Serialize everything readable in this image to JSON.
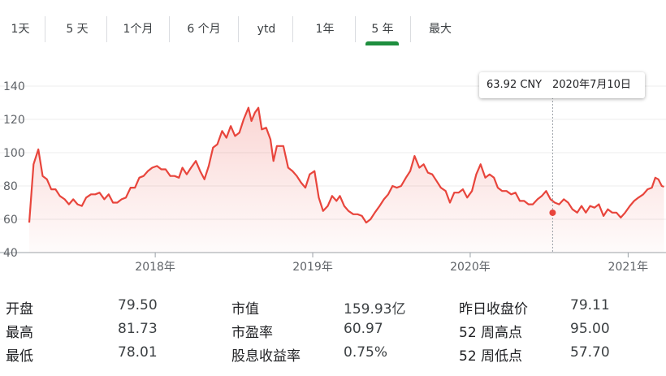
{
  "range_tabs": {
    "items": [
      {
        "label": "1天"
      },
      {
        "label": "5 天"
      },
      {
        "label": "1个月"
      },
      {
        "label": "6 个月"
      },
      {
        "label": "ytd"
      },
      {
        "label": "1年"
      },
      {
        "label": "5 年"
      },
      {
        "label": "最大"
      }
    ],
    "active_index": 6,
    "active_color": "#1e8e3e"
  },
  "tooltip": {
    "price": "63.92 CNY",
    "date": "2020年7月10日"
  },
  "chart_data": {
    "type": "area",
    "line_color": "#e8453c",
    "ylim": [
      40,
      140
    ],
    "yticks": [
      40,
      60,
      80,
      100,
      120,
      140
    ],
    "xticks": [
      {
        "label": "2018年",
        "date": "2018-01-01"
      },
      {
        "label": "2019年",
        "date": "2019-01-01"
      },
      {
        "label": "2020年",
        "date": "2020-01-01"
      },
      {
        "label": "2021年",
        "date": "2021-01-01"
      }
    ],
    "grid": true,
    "highlight": {
      "date": "2020-07-10",
      "value": 63.92
    },
    "series": [
      {
        "points": [
          [
            "2017-03-15",
            58
          ],
          [
            "2017-03-25",
            93
          ],
          [
            "2017-04-05",
            102
          ],
          [
            "2017-04-15",
            86
          ],
          [
            "2017-04-25",
            84
          ],
          [
            "2017-05-05",
            78
          ],
          [
            "2017-05-15",
            78
          ],
          [
            "2017-05-25",
            74
          ],
          [
            "2017-06-05",
            72
          ],
          [
            "2017-06-15",
            69
          ],
          [
            "2017-06-25",
            72
          ],
          [
            "2017-07-05",
            69
          ],
          [
            "2017-07-15",
            68
          ],
          [
            "2017-07-25",
            73
          ],
          [
            "2017-08-05",
            75
          ],
          [
            "2017-08-15",
            75
          ],
          [
            "2017-08-25",
            76
          ],
          [
            "2017-09-05",
            72
          ],
          [
            "2017-09-15",
            75
          ],
          [
            "2017-09-25",
            70
          ],
          [
            "2017-10-05",
            70
          ],
          [
            "2017-10-15",
            72
          ],
          [
            "2017-10-25",
            73
          ],
          [
            "2017-11-05",
            79
          ],
          [
            "2017-11-15",
            79
          ],
          [
            "2017-11-25",
            85
          ],
          [
            "2017-12-05",
            86
          ],
          [
            "2017-12-15",
            89
          ],
          [
            "2017-12-25",
            91
          ],
          [
            "2018-01-05",
            92
          ],
          [
            "2018-01-15",
            90
          ],
          [
            "2018-01-25",
            90
          ],
          [
            "2018-02-05",
            86
          ],
          [
            "2018-02-15",
            86
          ],
          [
            "2018-02-25",
            85
          ],
          [
            "2018-03-05",
            91
          ],
          [
            "2018-03-15",
            87
          ],
          [
            "2018-03-25",
            91
          ],
          [
            "2018-04-05",
            95
          ],
          [
            "2018-04-15",
            89
          ],
          [
            "2018-04-25",
            84
          ],
          [
            "2018-05-05",
            92
          ],
          [
            "2018-05-15",
            103
          ],
          [
            "2018-05-25",
            105
          ],
          [
            "2018-06-05",
            113
          ],
          [
            "2018-06-15",
            109
          ],
          [
            "2018-06-25",
            116
          ],
          [
            "2018-07-05",
            110
          ],
          [
            "2018-07-15",
            112
          ],
          [
            "2018-07-25",
            120
          ],
          [
            "2018-08-05",
            127
          ],
          [
            "2018-08-12",
            119
          ],
          [
            "2018-08-20",
            124
          ],
          [
            "2018-08-28",
            127
          ],
          [
            "2018-09-05",
            114
          ],
          [
            "2018-09-15",
            115
          ],
          [
            "2018-09-25",
            108
          ],
          [
            "2018-10-02",
            95
          ],
          [
            "2018-10-10",
            104
          ],
          [
            "2018-10-25",
            104
          ],
          [
            "2018-11-05",
            91
          ],
          [
            "2018-11-15",
            89
          ],
          [
            "2018-11-25",
            86
          ],
          [
            "2018-12-05",
            82
          ],
          [
            "2018-12-15",
            79
          ],
          [
            "2018-12-25",
            87
          ],
          [
            "2019-01-05",
            89
          ],
          [
            "2019-01-15",
            73
          ],
          [
            "2019-01-25",
            65
          ],
          [
            "2019-02-05",
            68
          ],
          [
            "2019-02-15",
            74
          ],
          [
            "2019-02-25",
            71
          ],
          [
            "2019-03-05",
            74
          ],
          [
            "2019-03-15",
            68
          ],
          [
            "2019-03-25",
            65
          ],
          [
            "2019-04-05",
            63
          ],
          [
            "2019-04-15",
            63
          ],
          [
            "2019-04-25",
            62
          ],
          [
            "2019-05-05",
            58
          ],
          [
            "2019-05-15",
            60
          ],
          [
            "2019-05-25",
            64
          ],
          [
            "2019-06-05",
            68
          ],
          [
            "2019-06-15",
            72
          ],
          [
            "2019-06-25",
            75
          ],
          [
            "2019-07-05",
            80
          ],
          [
            "2019-07-15",
            79
          ],
          [
            "2019-07-25",
            80
          ],
          [
            "2019-08-05",
            85
          ],
          [
            "2019-08-15",
            89
          ],
          [
            "2019-08-25",
            98
          ],
          [
            "2019-09-05",
            91
          ],
          [
            "2019-09-15",
            93
          ],
          [
            "2019-09-25",
            88
          ],
          [
            "2019-10-05",
            87
          ],
          [
            "2019-10-15",
            83
          ],
          [
            "2019-10-25",
            79
          ],
          [
            "2019-11-05",
            77
          ],
          [
            "2019-11-15",
            70
          ],
          [
            "2019-11-25",
            76
          ],
          [
            "2019-12-05",
            76
          ],
          [
            "2019-12-15",
            78
          ],
          [
            "2019-12-25",
            73
          ],
          [
            "2020-01-05",
            77
          ],
          [
            "2020-01-15",
            87
          ],
          [
            "2020-01-25",
            93
          ],
          [
            "2020-02-05",
            85
          ],
          [
            "2020-02-15",
            87
          ],
          [
            "2020-02-25",
            85
          ],
          [
            "2020-03-05",
            79
          ],
          [
            "2020-03-15",
            77
          ],
          [
            "2020-03-25",
            77
          ],
          [
            "2020-04-05",
            75
          ],
          [
            "2020-04-15",
            76
          ],
          [
            "2020-04-25",
            71
          ],
          [
            "2020-05-05",
            71
          ],
          [
            "2020-05-15",
            69
          ],
          [
            "2020-05-25",
            69
          ],
          [
            "2020-06-05",
            72
          ],
          [
            "2020-06-15",
            74
          ],
          [
            "2020-06-25",
            77
          ],
          [
            "2020-07-05",
            72
          ],
          [
            "2020-07-15",
            70
          ],
          [
            "2020-07-25",
            69
          ],
          [
            "2020-08-05",
            72
          ],
          [
            "2020-08-15",
            70
          ],
          [
            "2020-08-25",
            66
          ],
          [
            "2020-09-05",
            64
          ],
          [
            "2020-09-15",
            68
          ],
          [
            "2020-09-25",
            64
          ],
          [
            "2020-10-05",
            68
          ],
          [
            "2020-10-15",
            67
          ],
          [
            "2020-10-25",
            69
          ],
          [
            "2020-11-05",
            62
          ],
          [
            "2020-11-15",
            66
          ],
          [
            "2020-11-25",
            64
          ],
          [
            "2020-12-05",
            64
          ],
          [
            "2020-12-15",
            61
          ],
          [
            "2020-12-25",
            64
          ],
          [
            "2021-01-05",
            68
          ],
          [
            "2021-01-15",
            71
          ],
          [
            "2021-01-25",
            73
          ],
          [
            "2021-02-05",
            75
          ],
          [
            "2021-02-15",
            78
          ],
          [
            "2021-02-25",
            79
          ],
          [
            "2021-03-05",
            85
          ],
          [
            "2021-03-12",
            84
          ],
          [
            "2021-03-20",
            80
          ],
          [
            "2021-03-25",
            79.5
          ]
        ]
      }
    ]
  },
  "stats": [
    {
      "label": "开盘",
      "value": "79.50"
    },
    {
      "label": "市值",
      "value": "159.93亿"
    },
    {
      "label": "昨日收盘价",
      "value": "79.11"
    },
    {
      "label": "最高",
      "value": "81.73"
    },
    {
      "label": "市盈率",
      "value": "60.97"
    },
    {
      "label": "52 周高点",
      "value": "95.00"
    },
    {
      "label": "最低",
      "value": "78.01"
    },
    {
      "label": "股息收益率",
      "value": "0.75%"
    },
    {
      "label": "52 周低点",
      "value": "57.70"
    }
  ]
}
